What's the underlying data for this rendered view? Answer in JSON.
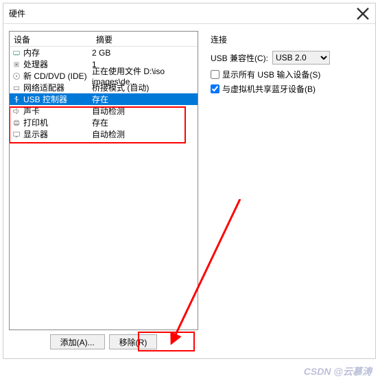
{
  "window": {
    "title": "硬件"
  },
  "device_list": {
    "header_device": "设备",
    "header_summary": "摘要",
    "items": [
      {
        "icon": "memory",
        "label": "内存",
        "summary": "2 GB"
      },
      {
        "icon": "cpu",
        "label": "处理器",
        "summary": "1"
      },
      {
        "icon": "cd",
        "label": "新 CD/DVD (IDE)",
        "summary": "正在使用文件 D:\\iso images\\de..."
      },
      {
        "icon": "network",
        "label": "网络适配器",
        "summary": "桥接模式 (自动)"
      },
      {
        "icon": "usb",
        "label": "USB 控制器",
        "summary": "存在"
      },
      {
        "icon": "sound",
        "label": "声卡",
        "summary": "自动检测"
      },
      {
        "icon": "printer",
        "label": "打印机",
        "summary": "存在"
      },
      {
        "icon": "display",
        "label": "显示器",
        "summary": "自动检测"
      }
    ],
    "selected_index": 4
  },
  "buttons": {
    "add": "添加(A)...",
    "remove": "移除(R)"
  },
  "connection": {
    "section_title": "连接",
    "compat_label": "USB 兼容性(C):",
    "compat_value": "USB 2.0",
    "checkbox1_label": "显示所有 USB 输入设备(S)",
    "checkbox1_checked": false,
    "checkbox2_label": "与虚拟机共享蓝牙设备(B)",
    "checkbox2_checked": true
  },
  "watermark": "CSDN @云慕涛"
}
